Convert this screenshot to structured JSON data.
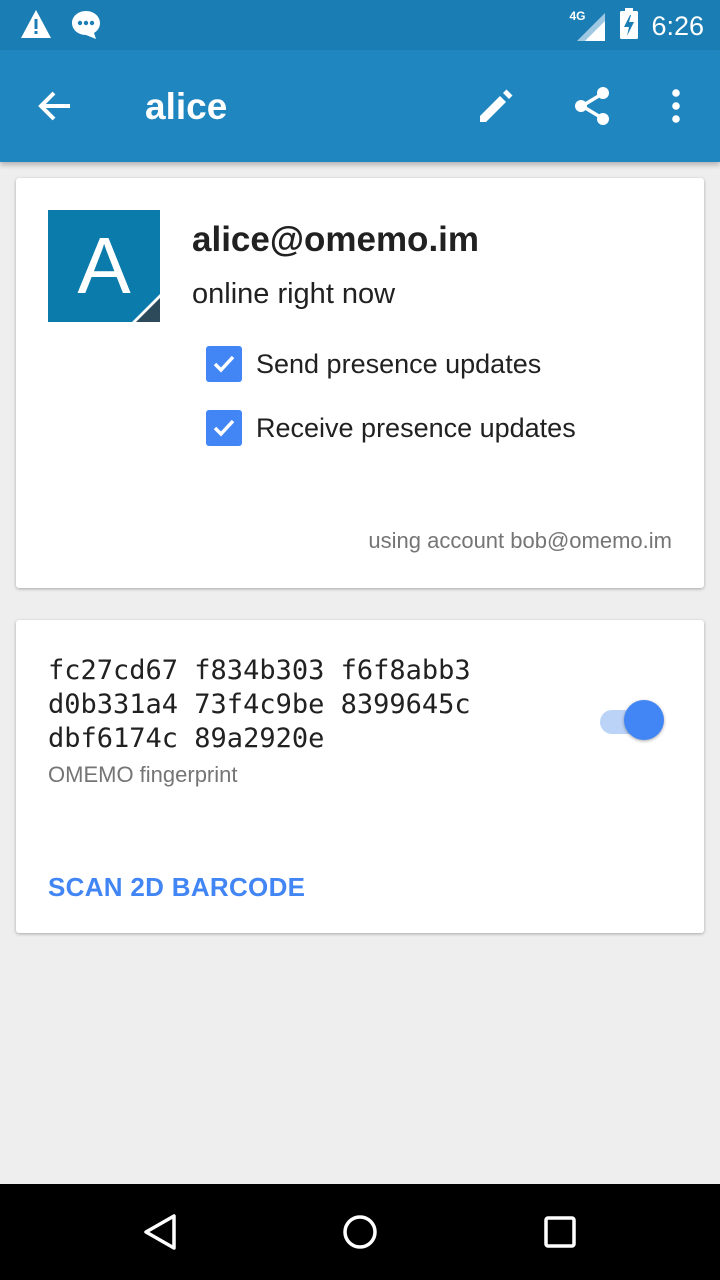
{
  "status_bar": {
    "time": "6:26",
    "network": "4G",
    "icons": [
      "warning-icon",
      "chat-bubble-icon",
      "signal-icon",
      "battery-charging-icon"
    ]
  },
  "toolbar": {
    "title": "alice",
    "icons": [
      "back-arrow-icon",
      "edit-pencil-icon",
      "share-icon",
      "more-vert-icon"
    ]
  },
  "contact": {
    "avatar_letter": "A",
    "jid": "alice@omemo.im",
    "status": "online right now",
    "send_presence_label": "Send presence updates",
    "receive_presence_label": "Receive presence updates",
    "send_presence_checked": true,
    "receive_presence_checked": true,
    "account": "using account bob@omemo.im"
  },
  "omemo": {
    "fingerprint": "fc27cd67 f834b303 f6f8abb3\nd0b331a4 73f4c9be 8399645c\ndbf6174c 89a2920e",
    "label": "OMEMO fingerprint",
    "trusted": true,
    "scan_label": "SCAN 2D BARCODE"
  },
  "colors": {
    "toolbar": "#1f86c0",
    "status_bar": "#1a7eb4",
    "accent": "#4285f4",
    "avatar": "#0b7bab"
  }
}
